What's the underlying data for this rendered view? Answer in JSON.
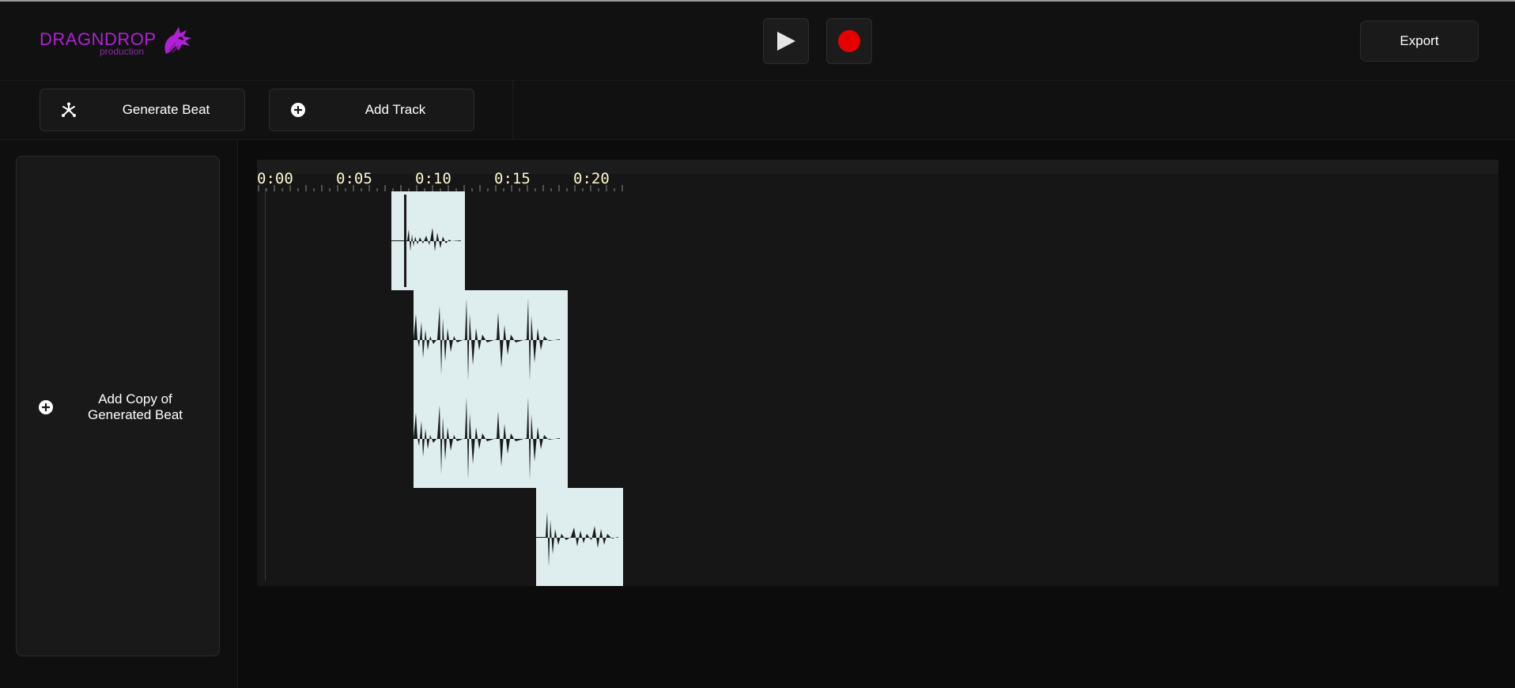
{
  "app": {
    "logo_text": "DRAGNDROP",
    "logo_subtext": "production"
  },
  "transport": {
    "play_icon": "play-icon",
    "record_icon": "record-icon",
    "record_color": "#e60000"
  },
  "header": {
    "export_label": "Export"
  },
  "toolbar": {
    "generate_beat_label": "Generate Beat",
    "generate_beat_icon": "sparkle-icon",
    "add_track_label": "Add Track",
    "add_track_icon": "plus-circle-icon"
  },
  "sidebar": {
    "copy_card_label_line1": "Add Copy of",
    "copy_card_label_line2": "Generated Beat",
    "copy_card_icon": "plus-circle-icon"
  },
  "timeline": {
    "ruler_labels": [
      "0:00",
      "0:05",
      "0:10",
      "0:15",
      "0:20"
    ],
    "clip_color": "#deeeef",
    "accent": "#b021d6"
  }
}
